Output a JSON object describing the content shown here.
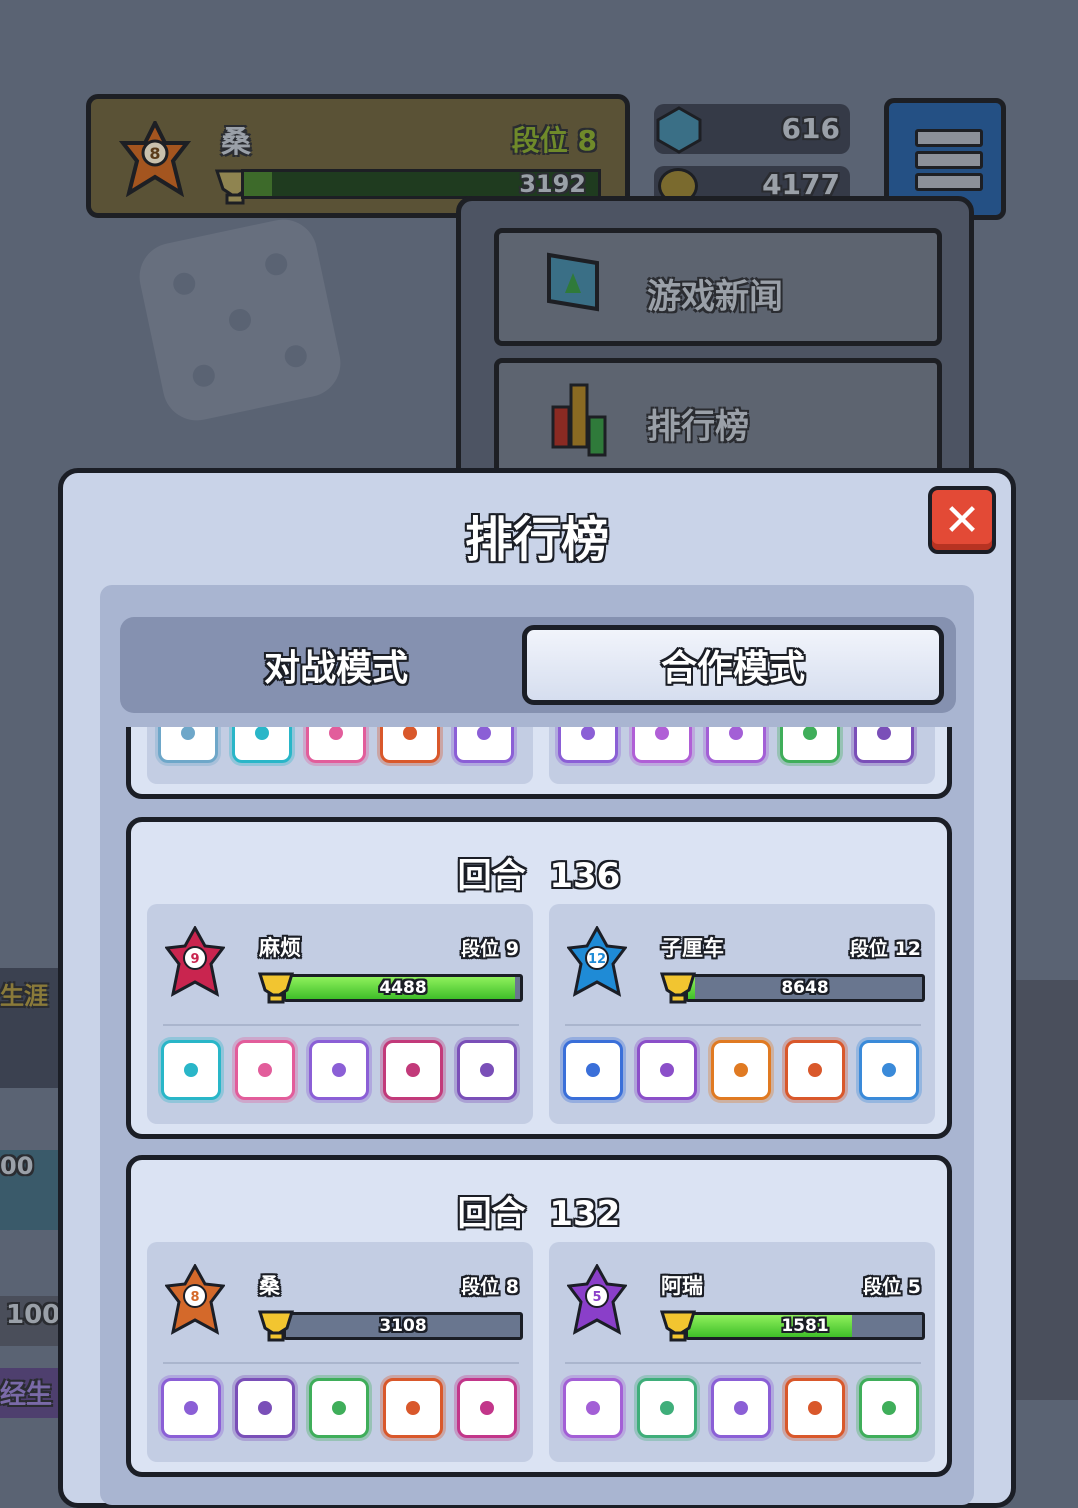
{
  "header": {
    "player_name": "桑",
    "rank_label": "段位 8",
    "badge_level": "8",
    "trophies": "3192",
    "trophy_fill": 0.08,
    "gems": "616",
    "gold": "4177"
  },
  "dropdown": {
    "items": [
      {
        "label": "游戏新闻",
        "icon": "news-monitor-icon"
      },
      {
        "label": "排行榜",
        "icon": "bar-chart-icon"
      }
    ]
  },
  "background": {
    "left_texts": [
      "生涯",
      "00",
      "100",
      "经生"
    ]
  },
  "modal": {
    "title": "排行榜",
    "close_icon": "close-x-icon",
    "tabs": [
      {
        "label": "对战模式",
        "active": false
      },
      {
        "label": "合作模式",
        "active": true
      }
    ]
  },
  "entries": [
    {
      "round_label": "回合",
      "round_value": "136",
      "players": [
        {
          "name": "麻烦",
          "rank_text": "段位",
          "rank_num": "9",
          "badge_level": "9",
          "badge_color": "#c9254f",
          "score": "4488",
          "fill": 0.98,
          "dice": [
            "#29b6c8",
            "#e25d9b",
            "#8b5fd6",
            "#c23a7a",
            "#7a4fb8"
          ]
        },
        {
          "name": "子厘车",
          "rank_text": "段位",
          "rank_num": "12",
          "badge_level": "12",
          "badge_color": "#1f8bd6",
          "score": "8648",
          "fill": 0.03,
          "dice": [
            "#3a6fd9",
            "#8b4fc9",
            "#e07a22",
            "#d9582b",
            "#3a8ad9"
          ]
        }
      ]
    },
    {
      "round_label": "回合",
      "round_value": "132",
      "players": [
        {
          "name": "桑",
          "rank_text": "段位",
          "rank_num": "8",
          "badge_level": "8",
          "badge_color": "#d4692a",
          "score": "3108",
          "fill": 0.0,
          "dice": [
            "#8b5fd6",
            "#7a4fb8",
            "#3fae5a",
            "#d9582b",
            "#c2368a"
          ]
        },
        {
          "name": "阿瑞",
          "rank_text": "段位",
          "rank_num": "5",
          "badge_level": "5",
          "badge_color": "#8a3fc9",
          "score": "1581",
          "fill": 0.7,
          "dice": [
            "#a35fd6",
            "#3fae7a",
            "#8b5fd6",
            "#d9582b",
            "#3fae5a"
          ]
        }
      ]
    }
  ],
  "partial_entry_dice": [
    [
      "#6ea7c9",
      "#29b6c8",
      "#e25d9b",
      "#d9582b",
      "#8b5fd6"
    ],
    [
      "#8b5fd6",
      "#b05fd6",
      "#a35fd6",
      "#3fae5a",
      "#7a4fb8"
    ]
  ]
}
